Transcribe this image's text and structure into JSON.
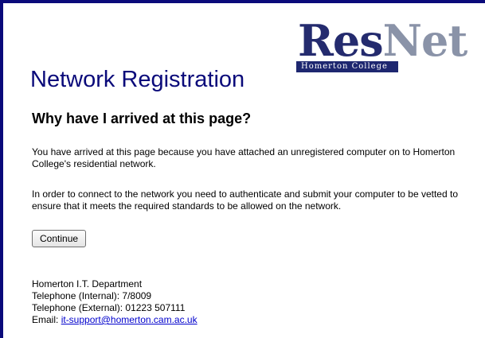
{
  "logo": {
    "word_part1": "Res",
    "word_part2": "Net",
    "subtitle": "Homerton College"
  },
  "header": {
    "title": "Network Registration"
  },
  "main": {
    "heading": "Why have I arrived at this page?",
    "paragraph1": "You have arrived at this page because you have attached an unregistered computer on to Homerton College's residential network.",
    "paragraph2": "In order to connect to the network you need to authenticate and submit your computer to be vetted to ensure that it meets the required standards to be allowed on the network.",
    "continue_label": "Continue"
  },
  "contact": {
    "department": "Homerton I.T. Department",
    "phone_internal": "Telephone (Internal): 7/8009",
    "phone_external": "Telephone (External): 01223 507111",
    "email_label": "Email: ",
    "email": "it-support@homerton.cam.ac.uk"
  },
  "colors": {
    "border": "#0a0a7a",
    "title": "#0a0a7a",
    "logo_dark": "#242b6e",
    "logo_light": "#8a93a8",
    "link": "#0000cc"
  }
}
